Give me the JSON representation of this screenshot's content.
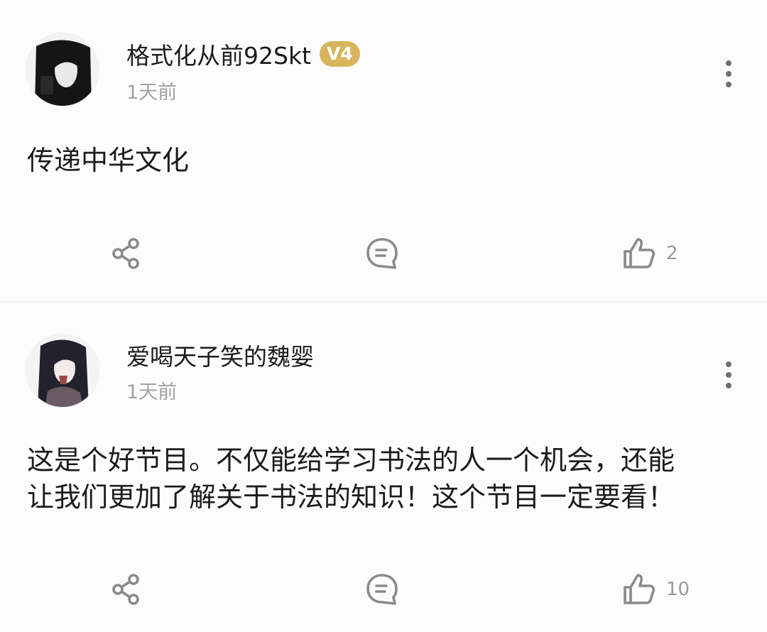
{
  "comments": [
    {
      "username": "格式化从前92Skt",
      "level_badge": "V4",
      "timestamp": "1天前",
      "text": "传递中华文化",
      "like_count": "2"
    },
    {
      "username": "爱喝天子笑的魏婴",
      "timestamp": "1天前",
      "text": "这是个好节目。不仅能给学习书法的人一个机会，还能\n让我们更加了解关于书法的知识！这个节目一定要看！",
      "like_count": "10"
    }
  ],
  "colors": {
    "badge": "#d8b45c",
    "icon": "#8a8a8a",
    "meta_text": "#a2a2a2"
  },
  "icons": {
    "share": "share-icon",
    "comment": "comment-bubble-icon",
    "like": "thumbs-up-icon",
    "more": "more-vertical-icon"
  }
}
